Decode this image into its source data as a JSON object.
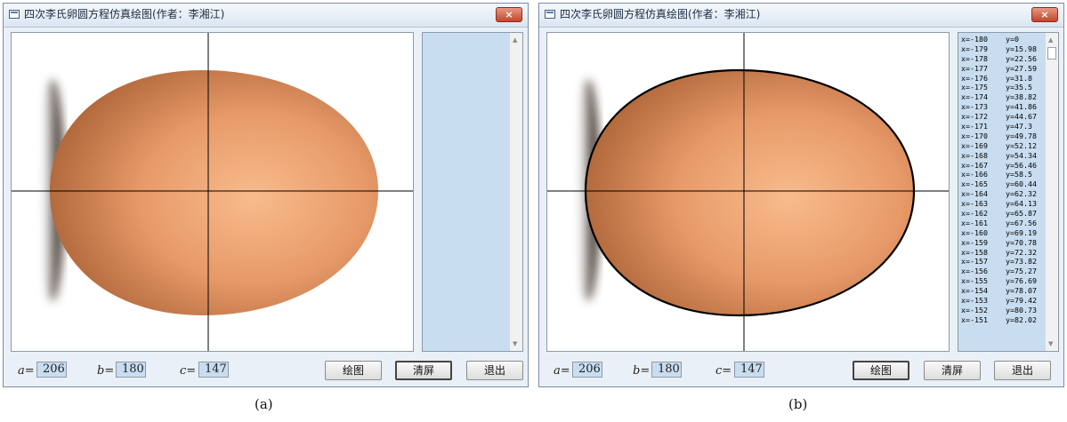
{
  "colors": {
    "egg_light": "#f8bb8c",
    "egg_mid": "#e39363",
    "egg_dark": "#b36a3d",
    "list_bg": "#c8ddf0",
    "close_red": "#c5432a"
  },
  "window_a": {
    "title": "四次李氏卵圆方程仿真绘图(作者：李湘江)",
    "close_glyph": "×",
    "params": {
      "a_label": "a=",
      "a_value": "206",
      "b_label": "b=",
      "b_value": "180",
      "c_label": "c=",
      "c_value": "147"
    },
    "buttons": {
      "draw": "绘图",
      "clear": "清屏",
      "exit": "退出"
    },
    "list_rows": []
  },
  "window_b": {
    "title": "四次李氏卵圆方程仿真绘图(作者：李湘江)",
    "close_glyph": "×",
    "params": {
      "a_label": "a=",
      "a_value": "206",
      "b_label": "b=",
      "b_value": "180",
      "c_label": "c=",
      "c_value": "147"
    },
    "buttons": {
      "draw": "绘图",
      "clear": "清屏",
      "exit": "退出"
    },
    "list_rows": [
      {
        "x": "x=-180",
        "y": "y=0"
      },
      {
        "x": "x=-179",
        "y": "y=15.98"
      },
      {
        "x": "x=-178",
        "y": "y=22.56"
      },
      {
        "x": "x=-177",
        "y": "y=27.59"
      },
      {
        "x": "x=-176",
        "y": "y=31.8"
      },
      {
        "x": "x=-175",
        "y": "y=35.5"
      },
      {
        "x": "x=-174",
        "y": "y=38.82"
      },
      {
        "x": "x=-173",
        "y": "y=41.86"
      },
      {
        "x": "x=-172",
        "y": "y=44.67"
      },
      {
        "x": "x=-171",
        "y": "y=47.3"
      },
      {
        "x": "x=-170",
        "y": "y=49.78"
      },
      {
        "x": "x=-169",
        "y": "y=52.12"
      },
      {
        "x": "x=-168",
        "y": "y=54.34"
      },
      {
        "x": "x=-167",
        "y": "y=56.46"
      },
      {
        "x": "x=-166",
        "y": "y=58.5"
      },
      {
        "x": "x=-165",
        "y": "y=60.44"
      },
      {
        "x": "x=-164",
        "y": "y=62.32"
      },
      {
        "x": "x=-163",
        "y": "y=64.13"
      },
      {
        "x": "x=-162",
        "y": "y=65.87"
      },
      {
        "x": "x=-161",
        "y": "y=67.56"
      },
      {
        "x": "x=-160",
        "y": "y=69.19"
      },
      {
        "x": "x=-159",
        "y": "y=70.78"
      },
      {
        "x": "x=-158",
        "y": "y=72.32"
      },
      {
        "x": "x=-157",
        "y": "y=73.82"
      },
      {
        "x": "x=-156",
        "y": "y=75.27"
      },
      {
        "x": "x=-155",
        "y": "y=76.69"
      },
      {
        "x": "x=-154",
        "y": "y=78.07"
      },
      {
        "x": "x=-153",
        "y": "y=79.42"
      },
      {
        "x": "x=-152",
        "y": "y=80.73"
      },
      {
        "x": "x=-151",
        "y": "y=82.02"
      }
    ]
  },
  "captions": {
    "a": "(a)",
    "b": "(b)"
  }
}
